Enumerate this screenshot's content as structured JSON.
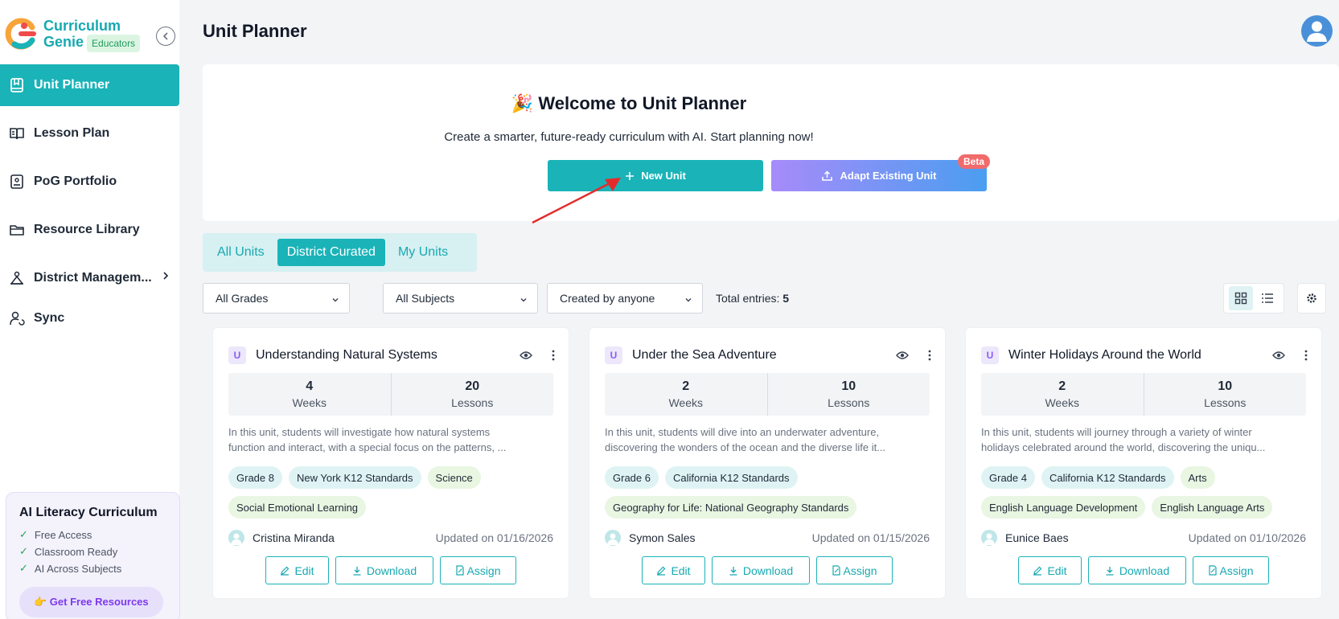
{
  "brand": {
    "line1": "Curriculum",
    "line2": "Genie",
    "badge": "Educators"
  },
  "sidebar": {
    "items": [
      {
        "label": "Unit Planner",
        "icon": "book-icon",
        "active": true
      },
      {
        "label": "Lesson Plan",
        "icon": "open-book-icon",
        "active": false
      },
      {
        "label": "PoG Portfolio",
        "icon": "portfolio-icon",
        "active": false
      },
      {
        "label": "Resource Library",
        "icon": "folder-icon",
        "active": false
      },
      {
        "label": "District Managem...",
        "icon": "hierarchy-icon",
        "active": false
      },
      {
        "label": "Sync",
        "icon": "sync-user-icon",
        "active": false
      }
    ]
  },
  "promo": {
    "title": "AI Literacy Curriculum",
    "items": [
      "Free Access",
      "Classroom Ready",
      "AI Across Subjects"
    ],
    "button": "👉 Get Free Resources"
  },
  "header": {
    "title": "Unit Planner"
  },
  "welcome": {
    "emoji": "🎉",
    "title": "Welcome to Unit Planner",
    "subtitle": "Create a smarter, future-ready curriculum with AI. Start planning now!",
    "new_unit": "New Unit",
    "adapt_unit": "Adapt Existing Unit",
    "beta": "Beta"
  },
  "tabs": [
    "All Units",
    "District Curated",
    "My Units"
  ],
  "active_tab": "District Curated",
  "filters": {
    "grades": "All Grades",
    "subjects": "All Subjects",
    "creator": "Created by anyone",
    "total_label": "Total entries:",
    "total_value": "5"
  },
  "cards": [
    {
      "icon_letter": "U",
      "title": "Understanding Natural Systems",
      "weeks": "4",
      "weeks_label": "Weeks",
      "lessons": "20",
      "lessons_label": "Lessons",
      "desc1": "In this unit, students will investigate how natural systems",
      "desc2": "function and interact, with a special focus on the patterns, ...",
      "tags": [
        {
          "text": "Grade 8",
          "kind": "grade"
        },
        {
          "text": "New York K12 Standards",
          "kind": "std"
        },
        {
          "text": "Science",
          "kind": "subj"
        },
        {
          "text": "Social Emotional Learning",
          "kind": "subj"
        }
      ],
      "author": "Cristina Miranda",
      "updated": "Updated on 01/16/2026"
    },
    {
      "icon_letter": "U",
      "title": "Under the Sea Adventure",
      "weeks": "2",
      "weeks_label": "Weeks",
      "lessons": "10",
      "lessons_label": "Lessons",
      "desc1": "In this unit, students will dive into an underwater adventure,",
      "desc2": "discovering the wonders of the ocean and the diverse life it...",
      "tags": [
        {
          "text": "Grade 6",
          "kind": "grade"
        },
        {
          "text": "California K12 Standards",
          "kind": "std"
        },
        {
          "text": "Geography for Life: National Geography Standards",
          "kind": "subj"
        }
      ],
      "author": "Symon Sales",
      "updated": "Updated on 01/15/2026"
    },
    {
      "icon_letter": "U",
      "title": "Winter Holidays Around the World",
      "weeks": "2",
      "weeks_label": "Weeks",
      "lessons": "10",
      "lessons_label": "Lessons",
      "desc1": "In this unit, students will journey through a variety of winter",
      "desc2": "holidays celebrated around the world, discovering the uniqu...",
      "tags": [
        {
          "text": "Grade 4",
          "kind": "grade"
        },
        {
          "text": "California K12 Standards",
          "kind": "std"
        },
        {
          "text": "Arts",
          "kind": "subj"
        },
        {
          "text": "English Language Development",
          "kind": "subj"
        },
        {
          "text": "English Language Arts",
          "kind": "subj"
        }
      ],
      "author": "Eunice Baes",
      "updated": "Updated on 01/10/2026"
    }
  ],
  "card_actions": {
    "edit": "Edit",
    "download": "Download",
    "assign": "Assign"
  },
  "colors": {
    "accent": "#1ab3b8",
    "brand": "#17a9b2",
    "purple": "#8b5cf6",
    "beta": "#f16b6b"
  }
}
